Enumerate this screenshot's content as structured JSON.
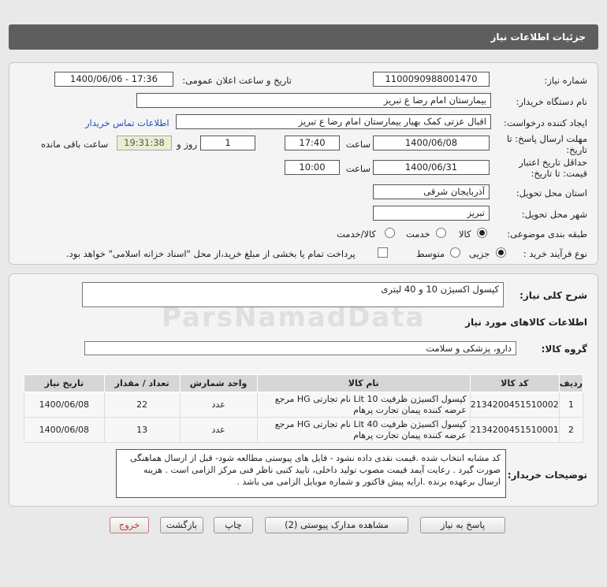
{
  "header": {
    "title": "جزئیات اطلاعات نیاز"
  },
  "form": {
    "need_number_label": "شماره نیاز:",
    "need_number": "1100090988001470",
    "announce_label": "تاریخ و ساعت اعلان عمومی:",
    "announce_value": "1400/06/06 - 17:36",
    "buyer_org_label": "نام دستگاه خریدار:",
    "buyer_org": "بیمارستان امام رضا  ع  تبریز",
    "creator_label": "ایجاد کننده درخواست:",
    "creator": "اقبال عزتی کمک بهیار بیمارستان امام رضا  ع  تبریز",
    "contact_link": "اطلاعات تماس خریدار",
    "deadline_label_1": "مهلت ارسال پاسخ: تا",
    "deadline_label_2": "تاریخ:",
    "deadline_date": "1400/06/08",
    "time_label": "ساعت",
    "deadline_time": "17:40",
    "days_value": "1",
    "days_label": "روز و",
    "remaining_time": "19:31:38",
    "remaining_label": "ساعت باقی مانده",
    "validity_label_1": "حداقل تاریخ اعتبار",
    "validity_label_2": "قیمت: تا تاریخ:",
    "validity_date": "1400/06/31",
    "validity_time_label": "ساعت",
    "validity_time": "10:00",
    "province_label": "استان محل تحویل:",
    "province": "آذربایجان شرقی",
    "city_label": "شهر محل تحویل:",
    "city": "تبریز",
    "category_label": "طبقه بندی موضوعی:",
    "category_options": [
      "کالا",
      "خدمت",
      "کالا/خدمت"
    ],
    "process_label": "نوع فرآیند خرید :",
    "process_options": [
      "جزیی",
      "متوسط"
    ],
    "payment_note": "پرداخت تمام یا بخشی از مبلغ خرید،از محل \"اسناد خزانه اسلامی\" خواهد بود."
  },
  "summary": {
    "label": "شرح کلی نیاز:",
    "value": "کپسول اکسیژن 10 و 40 لیتری",
    "goods_info_title": "اطلاعات کالاهای مورد نیاز",
    "group_label": "گروه کالا:",
    "group_value": "دارو، پزشکی و سلامت"
  },
  "table": {
    "headers": [
      "ردیف",
      "کد کالا",
      "نام کالا",
      "واحد شمارش",
      "تعداد / مقدار",
      "تاریخ نیاز"
    ],
    "rows": [
      {
        "index": "1",
        "code": "2134200451510002",
        "name": "کپسول اکسیژن ظرفیت Lit 10 نام تجارتی HG مرجع عرضه کننده پیمان تجارت پرهام",
        "unit": "عدد",
        "qty": "22",
        "date": "1400/06/08"
      },
      {
        "index": "2",
        "code": "2134200451510001",
        "name": "کپسول اکسیژن ظرفیت Lit 40 نام تجارتی HG مرجع عرضه کننده پیمان تجارت پرهام",
        "unit": "عدد",
        "qty": "13",
        "date": "1400/06/08"
      }
    ]
  },
  "notes": {
    "label": "توضیحات خریدار:",
    "text": "کد مشابه انتخاب شده .قیمت نقدی داده نشود - فایل های پیوستی مطالعه شود- قبل از ارسال هماهنگی صورت گیرد . رعایت آیمد قیمت مصوب تولید داخلی، تایید کتبی ناظر فنی مرکز الزامی است . هزینه ارسال برعهده برنده .ارایه پیش فاکتور و شماره موبایل الزامی می باشد ."
  },
  "buttons": {
    "reply": "پاسخ به نیاز",
    "attachments": "مشاهده مدارک پیوستی (2)",
    "print": "چاپ",
    "back": "بازگشت",
    "exit": "خروج"
  },
  "watermark": "ParsNamadData",
  "colors": {
    "header_bg": "#5e5e5e",
    "link": "#1a4fc4",
    "timer_bg": "#ececd2",
    "exit_text": "#c0392b"
  }
}
